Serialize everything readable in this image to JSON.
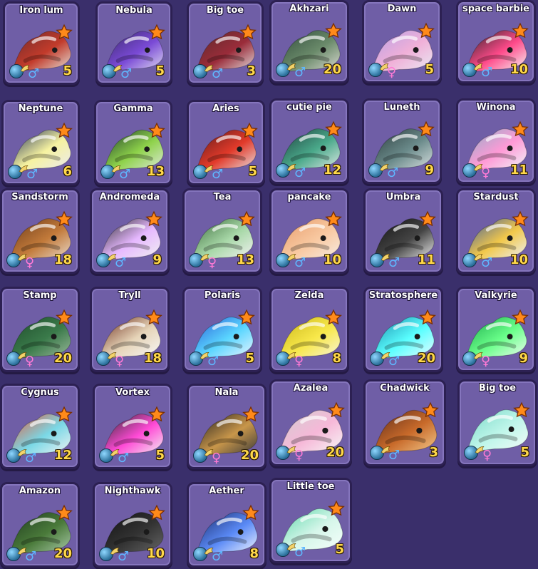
{
  "dragons": [
    {
      "name": "Iron lum",
      "level": "5",
      "gender": "male",
      "colors": [
        "#6b2b2b",
        "#c23b2b",
        "#e2ddd5"
      ]
    },
    {
      "name": "Nebula",
      "level": "5",
      "gender": "male",
      "colors": [
        "#3a2a6a",
        "#7a4ad6",
        "#dcd7f0"
      ]
    },
    {
      "name": "Big toe",
      "level": "3",
      "gender": "male",
      "colors": [
        "#5a2a2a",
        "#9a2c3a",
        "#e0d8d8"
      ]
    },
    {
      "name": "Akhzari",
      "level": "20",
      "gender": "male",
      "colors": [
        "#2f4a3a",
        "#6a8a6a",
        "#d8d8d0"
      ]
    },
    {
      "name": "Dawn",
      "level": "5",
      "gender": "female",
      "colors": [
        "#b4a0e6",
        "#f0b0d8",
        "#e8e8f2"
      ]
    },
    {
      "name": "space barbie",
      "level": "10",
      "gender": "male",
      "colors": [
        "#222222",
        "#ff4a8a",
        "#f5f5f5"
      ]
    },
    {
      "name": "Neptune",
      "level": "6",
      "gender": "male",
      "colors": [
        "#1e2e5a",
        "#f6f2a0",
        "#eaeaf0"
      ]
    },
    {
      "name": "Gamma",
      "level": "13",
      "gender": "male",
      "colors": [
        "#1c3a2a",
        "#8ed24a",
        "#dde8d8"
      ]
    },
    {
      "name": "Aries",
      "level": "5",
      "gender": "male",
      "colors": [
        "#5a1a1a",
        "#e23a2a",
        "#e8dcdc"
      ]
    },
    {
      "name": "cutie pie",
      "level": "12",
      "gender": "male",
      "colors": [
        "#1c3a3a",
        "#4aa98a",
        "#dce8e4"
      ]
    },
    {
      "name": "Luneth",
      "level": "9",
      "gender": "male",
      "colors": [
        "#2a3a3a",
        "#6a8a8a",
        "#d8e0e0"
      ]
    },
    {
      "name": "Winona",
      "level": "11",
      "gender": "female",
      "colors": [
        "#8ab0c8",
        "#ff9ad6",
        "#eef4f8"
      ]
    },
    {
      "name": "Sandstorm",
      "level": "18",
      "gender": "female",
      "colors": [
        "#6a3a1a",
        "#c27a3a",
        "#e8d8c8"
      ]
    },
    {
      "name": "Andromeda",
      "level": "9",
      "gender": "male",
      "colors": [
        "#2a2a2a",
        "#e6b8ff",
        "#f0f0f0"
      ]
    },
    {
      "name": "Tea",
      "level": "13",
      "gender": "female",
      "colors": [
        "#3a6a3a",
        "#a8d8a8",
        "#f2f2f2"
      ]
    },
    {
      "name": "pancake",
      "level": "10",
      "gender": "male",
      "colors": [
        "#e69a6a",
        "#f8c8a0",
        "#f6ece2"
      ]
    },
    {
      "name": "Umbra",
      "level": "11",
      "gender": "male",
      "colors": [
        "#111111",
        "#444444",
        "#eaeaea"
      ]
    },
    {
      "name": "Stardust",
      "level": "10",
      "gender": "male",
      "colors": [
        "#3a5aa0",
        "#f2c84a",
        "#eaf0f8"
      ]
    },
    {
      "name": "Stamp",
      "level": "20",
      "gender": "female",
      "colors": [
        "#1e4a2a",
        "#3a7a4a",
        "#9ab89a"
      ]
    },
    {
      "name": "Tryll",
      "level": "18",
      "gender": "female",
      "colors": [
        "#6a2a1a",
        "#e6d4b8",
        "#f8f8f8"
      ]
    },
    {
      "name": "Polaris",
      "level": "5",
      "gender": "male",
      "colors": [
        "#2a5ad6",
        "#5ad6ff",
        "#eaf4ff"
      ]
    },
    {
      "name": "Zelda",
      "level": "8",
      "gender": "female",
      "colors": [
        "#c8b41a",
        "#f8e84a",
        "#f8f4d8"
      ]
    },
    {
      "name": "Stratosphere",
      "level": "20",
      "gender": "male",
      "colors": [
        "#1a8aaa",
        "#5affff",
        "#e8fbff"
      ]
    },
    {
      "name": "Valkyrie",
      "level": "9",
      "gender": "female",
      "colors": [
        "#1aa84a",
        "#6aff8a",
        "#eefcf0"
      ]
    },
    {
      "name": "Cygnus",
      "level": "12",
      "gender": "male",
      "colors": [
        "#e65a3a",
        "#7ad8e6",
        "#f2f2f2"
      ]
    },
    {
      "name": "Vortex",
      "level": "5",
      "gender": "male",
      "colors": [
        "#2a2a2a",
        "#ff4ad6",
        "#f2f2f2"
      ]
    },
    {
      "name": "Nala",
      "level": "20",
      "gender": "female",
      "colors": [
        "#1e1e1e",
        "#c8964a",
        "#3a3a3a"
      ]
    },
    {
      "name": "Azalea",
      "level": "20",
      "gender": "female",
      "colors": [
        "#cfcfcf",
        "#f6b8d8",
        "#f6f6f6"
      ]
    },
    {
      "name": "Chadwick",
      "level": "3",
      "gender": "male",
      "colors": [
        "#5a2a1a",
        "#c86a2a",
        "#f2c88a"
      ]
    },
    {
      "name": "Big toe",
      "level": "5",
      "gender": "female",
      "colors": [
        "#7ad8c8",
        "#bff6ea",
        "#f2fbf8"
      ]
    },
    {
      "name": "Amazon",
      "level": "20",
      "gender": "male",
      "colors": [
        "#1e3a1e",
        "#4a7a3a",
        "#a8c8a8"
      ]
    },
    {
      "name": "Nighthawk",
      "level": "10",
      "gender": "male",
      "colors": [
        "#111111",
        "#333333",
        "#666666"
      ]
    },
    {
      "name": "Aether",
      "level": "8",
      "gender": "male",
      "colors": [
        "#1a2a6a",
        "#5a8af6",
        "#eef2ff"
      ]
    },
    {
      "name": "Little toe",
      "level": "5",
      "gender": "male",
      "colors": [
        "#5ad6a8",
        "#d6f6ea",
        "#f6fffb"
      ]
    }
  ],
  "icons": {
    "star": "star-icon",
    "globe": "element-globe-icon",
    "wing": "wing-icon"
  }
}
